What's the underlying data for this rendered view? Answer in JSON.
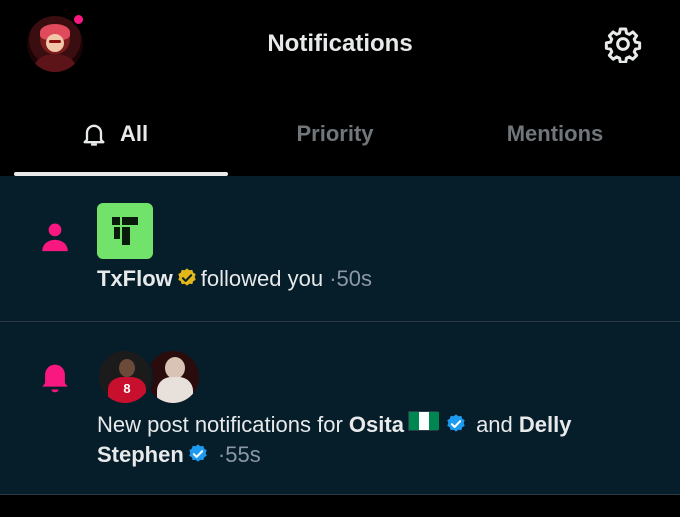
{
  "header": {
    "title": "Notifications",
    "avatar_icon": "profile-avatar",
    "settings_icon": "gear-icon"
  },
  "tabs": [
    {
      "label": "All",
      "active": true
    },
    {
      "label": "Priority",
      "active": false
    },
    {
      "label": "Mentions",
      "active": false
    }
  ],
  "notifications": [
    {
      "type": "follow",
      "icon": "person-icon",
      "actor": "TxFlow",
      "action": "followed you",
      "separator": "·",
      "time": "50s"
    },
    {
      "type": "new-post",
      "icon": "bell-icon",
      "prefix": "New post notifications for",
      "actor1": "Osita",
      "conjunction": "and",
      "actor2": "Delly Stephen",
      "separator": "·",
      "time": "55s"
    }
  ],
  "colors": {
    "accent_pink": "#f91880",
    "verified_blue": "#1d9bf0",
    "verified_gold": "#e2b719",
    "feed_bg": "#061d2a"
  }
}
